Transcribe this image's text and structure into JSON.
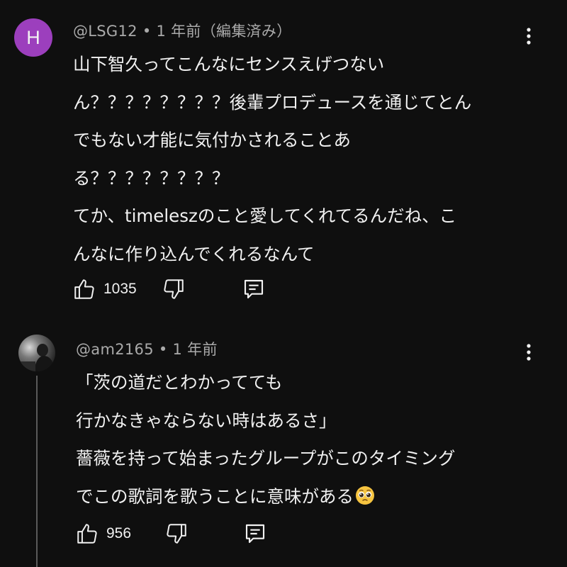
{
  "comments": [
    {
      "avatar": {
        "letter": "H",
        "color": "#9c3fbd"
      },
      "author": "@LSG12",
      "time": "1 年前（編集済み）",
      "lines": [
        "山下智久ってこんなにセンスえげつない",
        "ん？？？？？？？？後輩プロデュースを通じてとん",
        "でもない才能に気付かされることあ",
        "る？？？？？？？？",
        "てか、timeleszのこと愛してくれてるんだね、こ",
        "んなに作り込んでくれるなんて"
      ],
      "likes": "1035"
    },
    {
      "avatar": {
        "kind": "photo"
      },
      "author": "@am2165",
      "time": "1 年前",
      "lines": [
        "「茨の道だとわかってても",
        "行かなきゃならない時はあるさ」",
        "薔薇を持って始まったグループがこのタイミング",
        "でこの歌詞を歌うことに意味がある"
      ],
      "emoji": "pleading-face-emoji",
      "likes": "956"
    }
  ],
  "icons": {
    "like": "thumb-up-icon",
    "dislike": "thumb-down-icon",
    "reply": "reply-comment-icon",
    "menu": "more-vert-icon"
  },
  "colors": {
    "background": "#0f0f0f",
    "text": "#f1f1f1",
    "meta": "#aaaaaa",
    "avatar_h": "#9c3fbd"
  }
}
